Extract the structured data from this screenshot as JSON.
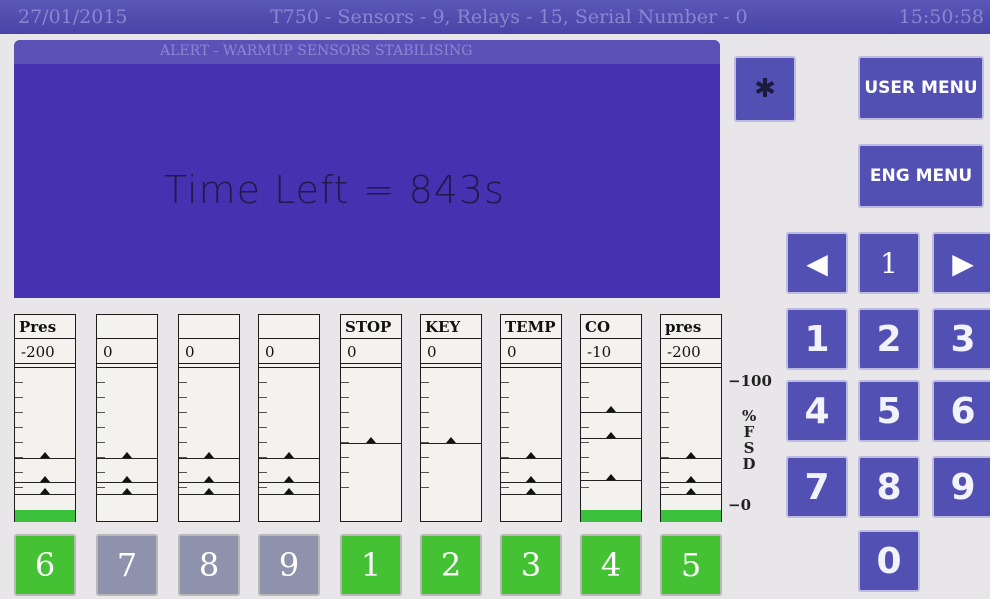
{
  "status_bar": {
    "date": "27/01/2015",
    "center": "T750 - Sensors - 9, Relays - 15, Serial Number - 0",
    "time": "15:50:58"
  },
  "alert_panel": {
    "header": "ALERT - WARMUP SENSORS STABILISING",
    "message": "Time Left = 843s"
  },
  "buttons": {
    "bluetooth_icon": "bluetooth-icon",
    "bluetooth_glyph": "✱",
    "user_menu": "USER MENU",
    "eng_menu": "ENG MENU"
  },
  "nav": {
    "prev_glyph": "◀",
    "current": "1",
    "next_glyph": "▶"
  },
  "keypad": [
    "1",
    "2",
    "3",
    "4",
    "5",
    "6",
    "7",
    "8",
    "9",
    "0"
  ],
  "scale": {
    "top": "−100",
    "bottom": "−0",
    "unit": "% F S D"
  },
  "gauges": [
    {
      "label": "Pres",
      "value": "-200"
    },
    {
      "label": "",
      "value": "0"
    },
    {
      "label": "",
      "value": "0"
    },
    {
      "label": "",
      "value": "0"
    },
    {
      "label": "STOP",
      "value": "0"
    },
    {
      "label": "KEY",
      "value": "0"
    },
    {
      "label": "TEMP",
      "value": "0"
    },
    {
      "label": "CO",
      "value": "-10"
    },
    {
      "label": "pres",
      "value": "-200"
    }
  ],
  "channel_buttons": [
    "6",
    "7",
    "8",
    "9",
    "1",
    "2",
    "3",
    "4",
    "5"
  ],
  "colors": {
    "active_channel": "#45c234",
    "inactive_channel": "#8f92ad",
    "panel": "#4632b0",
    "button": "#5350b4"
  }
}
